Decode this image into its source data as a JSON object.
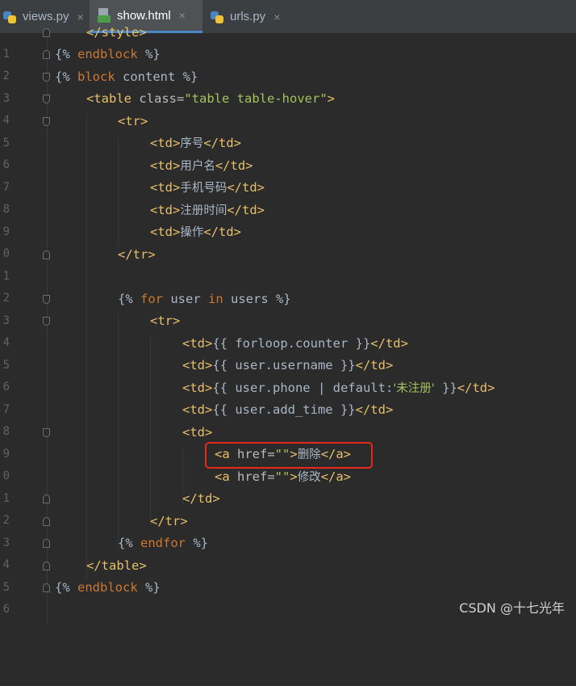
{
  "tabs": [
    {
      "label": "views.py",
      "icon": "python-file-icon",
      "active": false
    },
    {
      "label": "show.html",
      "icon": "html-file-icon",
      "active": true
    },
    {
      "label": "urls.py",
      "icon": "python-file-icon",
      "active": false
    }
  ],
  "close_glyph": "×",
  "line_numbers": [
    "1",
    "2",
    "3",
    "4",
    "5",
    "6",
    "7",
    "8",
    "9",
    "0",
    "1",
    "2",
    "3",
    "4",
    "5",
    "6",
    "7",
    "8",
    "9",
    "0",
    "1",
    "2",
    "3",
    "4",
    "5",
    "6"
  ],
  "code": {
    "l1": [
      "</style>"
    ],
    "l2": [
      "{% ",
      "endblock",
      " %}"
    ],
    "l3": [
      "{% ",
      "block",
      " content %}"
    ],
    "l4": [
      "<table ",
      "class",
      "=",
      "\"table table-hover\"",
      ">"
    ],
    "l5": [
      "<tr>"
    ],
    "l6": [
      "<td>",
      "序号",
      "</td>"
    ],
    "l7": [
      "<td>",
      "用户名",
      "</td>"
    ],
    "l8": [
      "<td>",
      "手机号码",
      "</td>"
    ],
    "l9": [
      "<td>",
      "注册时间",
      "</td>"
    ],
    "l10": [
      "<td>",
      "操作",
      "</td>"
    ],
    "l11": [
      "</tr>"
    ],
    "l13": [
      "{% ",
      "for",
      " user ",
      "in",
      " users %}"
    ],
    "l14": [
      "<tr>"
    ],
    "l15": [
      "<td>",
      "{{ forloop.counter }}",
      "</td>"
    ],
    "l16": [
      "<td>",
      "{{ user.username }}",
      "</td>"
    ],
    "l17": [
      "<td>",
      "{{ user.phone | default:",
      "'未注册'",
      " }}",
      "</td>"
    ],
    "l18": [
      "<td>",
      "{{ user.add_time }}",
      "</td>"
    ],
    "l19": [
      "<td>"
    ],
    "l20": [
      "<a ",
      "href",
      "=",
      "\"\"",
      ">",
      "删除",
      "</a>"
    ],
    "l21": [
      "<a ",
      "href",
      "=",
      "\"\"",
      ">",
      "修改",
      "</a>"
    ],
    "l22": [
      "</td>"
    ],
    "l23": [
      "</tr>"
    ],
    "l24": [
      "{% ",
      "endfor",
      " %}"
    ],
    "l25": [
      "</table>"
    ],
    "l26": [
      "{% ",
      "endblock",
      " %}"
    ]
  },
  "watermark": "CSDN @十七光年",
  "colors": {
    "background": "#2b2b2b",
    "tag": "#e8bf6a",
    "string": "#a5c25c",
    "keyword": "#cc7832",
    "highlight_box": "#e8271f"
  }
}
